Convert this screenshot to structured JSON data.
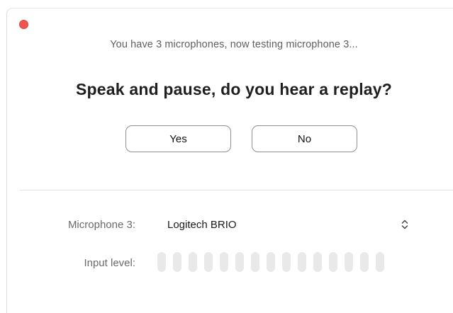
{
  "dialog": {
    "subtitle": "You have 3 microphones, now testing microphone 3...",
    "question": "Speak and pause, do you hear a replay?",
    "yes_label": "Yes",
    "no_label": "No"
  },
  "settings": {
    "microphone_label": "Microphone 3:",
    "microphone_value": "Logitech BRIO",
    "input_level_label": "Input level:",
    "input_level": 0,
    "input_level_segments": 15
  },
  "colors": {
    "close_button": "#f0554f",
    "level_segment_inactive": "#e9e9e9"
  },
  "icons": {
    "close": "close-icon",
    "select": "chevron-up-down-icon"
  }
}
